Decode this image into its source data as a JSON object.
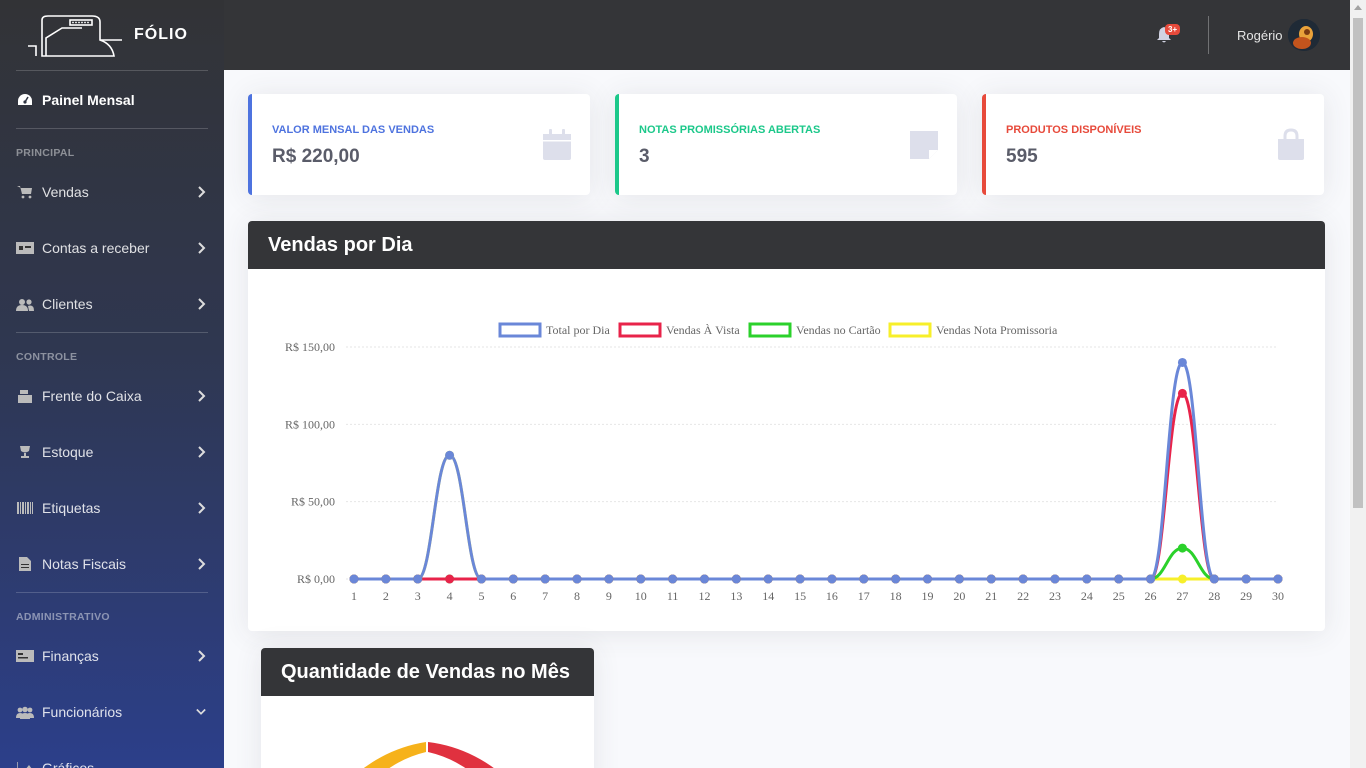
{
  "brand": {
    "name": "FÓLIO"
  },
  "sidebar": {
    "dashboard": "Painel Mensal",
    "sections": {
      "principal": "PRINCIPAL",
      "controle": "CONTROLE",
      "administrativo": "ADMINISTRATIVO"
    },
    "items": {
      "vendas": "Vendas",
      "contas": "Contas a receber",
      "clientes": "Clientes",
      "caixa": "Frente do Caixa",
      "estoque": "Estoque",
      "etiquetas": "Etiquetas",
      "notas": "Notas Fiscais",
      "financas": "Finanças",
      "funcionarios": "Funcionários",
      "graficos": "Gráficos"
    }
  },
  "topbar": {
    "notification_badge": "3+",
    "username": "Rogério"
  },
  "cards": [
    {
      "title": "VALOR MENSAL DAS VENDAS",
      "value": "R$ 220,00",
      "color": "#4e73df",
      "icon": "calendar-icon"
    },
    {
      "title": "NOTAS PROMISSÓRIAS ABERTAS",
      "value": "3",
      "color": "#1cc88a",
      "icon": "sticky-note-icon"
    },
    {
      "title": "PRODUTOS DISPONÍVEIS",
      "value": "595",
      "color": "#e74a3b",
      "icon": "shopping-bag-icon"
    }
  ],
  "chart_section": {
    "title": "Vendas por Dia"
  },
  "pie_section": {
    "title": "Quantidade de Vendas no Mês"
  },
  "chart_data": {
    "type": "line",
    "title": "Vendas por Dia",
    "x": [
      1,
      2,
      3,
      4,
      5,
      6,
      7,
      8,
      9,
      10,
      11,
      12,
      13,
      14,
      15,
      16,
      17,
      18,
      19,
      20,
      21,
      22,
      23,
      24,
      25,
      26,
      27,
      28,
      29,
      30
    ],
    "y_ticks": [
      "R$ 0,00",
      "R$ 50,00",
      "R$ 100,00",
      "R$ 150,00"
    ],
    "ylim": [
      0,
      150
    ],
    "legend_position": "top",
    "series": [
      {
        "name": "Total por Dia",
        "color": "#6a87d8",
        "values": [
          0,
          0,
          0,
          80,
          0,
          0,
          0,
          0,
          0,
          0,
          0,
          0,
          0,
          0,
          0,
          0,
          0,
          0,
          0,
          0,
          0,
          0,
          0,
          0,
          0,
          0,
          140,
          0,
          0,
          0
        ]
      },
      {
        "name": "Vendas À Vista",
        "color": "#e8234a",
        "values": [
          0,
          0,
          0,
          0,
          0,
          0,
          0,
          0,
          0,
          0,
          0,
          0,
          0,
          0,
          0,
          0,
          0,
          0,
          0,
          0,
          0,
          0,
          0,
          0,
          0,
          0,
          120,
          0,
          0,
          0
        ]
      },
      {
        "name": "Vendas no Cartão",
        "color": "#2bd12b",
        "values": [
          0,
          0,
          0,
          0,
          0,
          0,
          0,
          0,
          0,
          0,
          0,
          0,
          0,
          0,
          0,
          0,
          0,
          0,
          0,
          0,
          0,
          0,
          0,
          0,
          0,
          0,
          20,
          0,
          0,
          0
        ]
      },
      {
        "name": "Vendas Nota Promissoria",
        "color": "#f7ef2a",
        "values": [
          0,
          0,
          0,
          80,
          0,
          0,
          0,
          0,
          0,
          0,
          0,
          0,
          0,
          0,
          0,
          0,
          0,
          0,
          0,
          0,
          0,
          0,
          0,
          0,
          0,
          0,
          0,
          0,
          0,
          0
        ]
      }
    ]
  },
  "pie_preview": {
    "colors": [
      "#e0313f",
      "#f6b21b"
    ]
  }
}
